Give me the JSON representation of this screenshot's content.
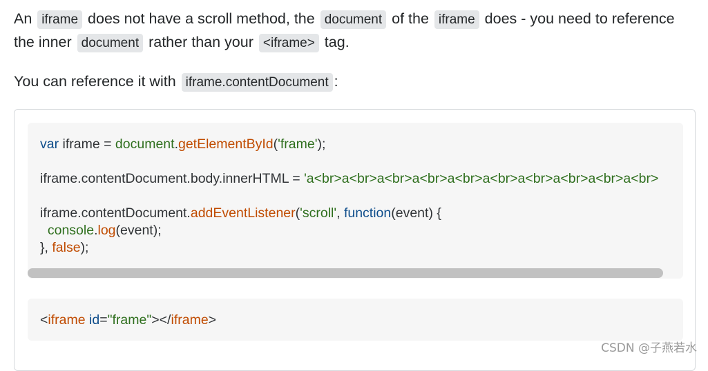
{
  "para1": {
    "t1": "An ",
    "c1": "iframe",
    "t2": " does not have a scroll method, the ",
    "c2": "document",
    "t3": " of the ",
    "c3": "iframe",
    "t4": " does - you need to reference the inner ",
    "c4": "document",
    "t5": " rather than your ",
    "c5": "<iframe>",
    "t6": " tag."
  },
  "para2": {
    "t1": "You can reference it with ",
    "c1": "iframe.contentDocument",
    "t2": ":"
  },
  "code_block_1": {
    "l1": {
      "a": "var",
      "b": " iframe = ",
      "c": "document",
      "d": ".",
      "e": "getElementById",
      "f": "(",
      "g": "'frame'",
      "h": ");"
    },
    "l3": {
      "a": "iframe.contentDocument.body.innerHTML = ",
      "b": "'a<br>a<br>a<br>a<br>a<br>a<br>a<br>a<br>a<br>a<br>"
    },
    "l5": {
      "a": "iframe.contentDocument.",
      "b": "addEventListener",
      "c": "(",
      "d": "'scroll'",
      "e": ", ",
      "f": "function",
      "g": "(event) {"
    },
    "l6": {
      "a": "  ",
      "b": "console",
      "c": ".",
      "d": "log",
      "e": "(event);"
    },
    "l7": {
      "a": "}, ",
      "b": "false",
      "c": ");"
    }
  },
  "code_block_2": {
    "l1": {
      "a": "<",
      "b": "iframe",
      "c": " ",
      "d": "id",
      "e": "=",
      "f": "\"frame\"",
      "g": "></",
      "h": "iframe",
      "i": ">"
    }
  },
  "colors": {
    "keyword": "#0e4d8b",
    "function": "#c04b00",
    "string": "#2f6f1e"
  },
  "watermark": "CSDN @子燕若水"
}
